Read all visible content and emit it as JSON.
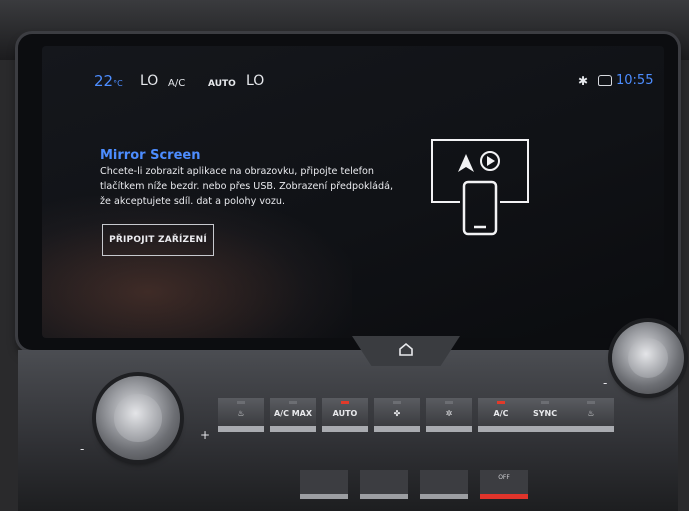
{
  "status_bar": {
    "temperature": "22",
    "temperature_unit": "°C",
    "fan_left": "LO",
    "ac": "A/C",
    "auto": "AUTO",
    "fan_right": "LO",
    "bluetooth_icon": "bluetooth-icon",
    "time": "10:55"
  },
  "mirror_screen": {
    "title": "Mirror Screen",
    "body": "Chcete-li zobrazit aplikace na obrazovku, připojte telefon tlačítkem níže bezdr. nebo přes USB. Zobrazení předpokládá, že akceptujete sdíl. dat a polohy vozu.",
    "connect_button": "PŘIPOJIT ZAŘÍZENÍ"
  },
  "climate_panel": {
    "minus_left": "-",
    "plus_left": "+",
    "minus_right": "-",
    "buttons": [
      {
        "label": "",
        "icon": "seat-heat-icon",
        "led": false
      },
      {
        "label": "A/C MAX",
        "icon": "",
        "led": false
      },
      {
        "label": "AUTO",
        "icon": "",
        "led": true
      },
      {
        "label": "",
        "icon": "fan-icon",
        "led": false
      },
      {
        "label": "",
        "icon": "fan-icon",
        "led": false
      },
      {
        "label": "A/C",
        "icon": "",
        "led": true
      },
      {
        "label": "SYNC",
        "icon": "",
        "led": false
      },
      {
        "label": "",
        "icon": "seat-heat-icon",
        "led": false
      }
    ],
    "lower_buttons": [
      "",
      "",
      "",
      "OFF"
    ]
  },
  "colors": {
    "accent": "#4d8dff",
    "led_on": "#e23a2a"
  }
}
